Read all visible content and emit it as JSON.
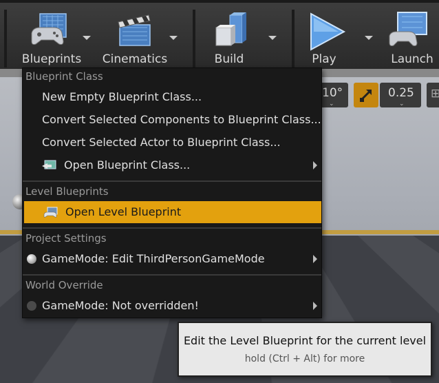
{
  "toolbar": {
    "items": [
      {
        "label": "Blueprints",
        "icon": "gamepad-blueprint-icon"
      },
      {
        "label": "Cinematics",
        "icon": "clapperboard-icon"
      },
      {
        "label": "Build",
        "icon": "build-blocks-icon"
      },
      {
        "label": "Play",
        "icon": "play-icon"
      },
      {
        "label": "Launch",
        "icon": "launch-monitor-icon"
      }
    ]
  },
  "viewport_controls": {
    "angle": "10°",
    "scale": "0.25"
  },
  "menu": {
    "sections": [
      {
        "header": "Blueprint Class",
        "items": [
          {
            "label": "New Empty Blueprint Class..."
          },
          {
            "label": "Convert Selected Components to Blueprint Class..."
          },
          {
            "label": "Convert Selected Actor to Blueprint Class..."
          },
          {
            "label": "Open Blueprint Class...",
            "icon": "blueprint-open-icon",
            "submenu": true
          }
        ]
      },
      {
        "header": "Level Blueprints",
        "items": [
          {
            "label": "Open Level Blueprint",
            "icon": "level-blueprint-icon",
            "highlighted": true
          }
        ]
      },
      {
        "header": "Project Settings",
        "items": [
          {
            "label": "GameMode: Edit ThirdPersonGameMode",
            "icon": "gamemode-sphere-icon",
            "submenu": true
          }
        ]
      },
      {
        "header": "World Override",
        "items": [
          {
            "label": "GameMode: Not overridden!",
            "icon": "gamemode-dot-icon",
            "submenu": true
          }
        ]
      }
    ]
  },
  "tooltip": {
    "main": "Edit the Level Blueprint for the current level",
    "sub": "hold (Ctrl + Alt) for more"
  },
  "colors": {
    "highlight": "#e3a10e",
    "menu_bg": "#191919",
    "toolbar_bg": "#2f2f2f"
  }
}
